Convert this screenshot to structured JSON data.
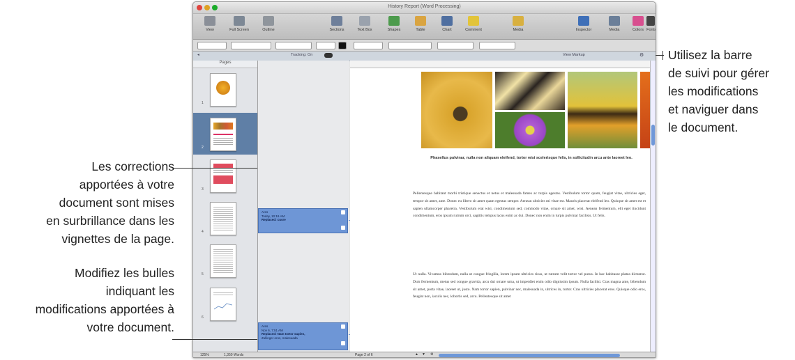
{
  "annotations": {
    "right": [
      "Utilisez la barre",
      "de suivi pour gérer",
      "les modifications",
      "et naviguer dans",
      "le document."
    ],
    "left_top": [
      "Les corrections",
      "apportées à votre",
      "document sont mises",
      "en surbrillance dans les",
      "vignettes de la page."
    ],
    "left_bottom": [
      "Modifiez les bulles",
      "indiquant les",
      "modifications apportées à",
      "votre document."
    ]
  },
  "window": {
    "title": "History Report (Word Processing)"
  },
  "toolbar": {
    "items": [
      {
        "label": "View",
        "icon": "view-icon"
      },
      {
        "label": "Full Screen",
        "icon": "full-screen-icon"
      },
      {
        "label": "Outline",
        "icon": "outline-icon"
      },
      {
        "label": "Sections",
        "icon": "sections-icon"
      },
      {
        "label": "Text Box",
        "icon": "text-box-icon"
      },
      {
        "label": "Shapes",
        "icon": "shapes-icon"
      },
      {
        "label": "Table",
        "icon": "table-icon"
      },
      {
        "label": "Chart",
        "icon": "chart-icon"
      },
      {
        "label": "Comment",
        "icon": "comment-icon"
      },
      {
        "label": "Media",
        "icon": "media-icon"
      },
      {
        "label": "Inspector",
        "icon": "inspector-icon"
      },
      {
        "label": "Media",
        "icon": "media-browser-icon"
      },
      {
        "label": "Colors",
        "icon": "colors-icon"
      },
      {
        "label": "Fonts",
        "icon": "fonts-icon"
      }
    ]
  },
  "trackbar": {
    "tracking_label": "Tracking: On",
    "view_label": "View Markup"
  },
  "sidebar": {
    "header": "Pages",
    "pages": [
      "1",
      "2",
      "3",
      "4",
      "5",
      "6"
    ]
  },
  "bubbles": [
    {
      "author": "Ares",
      "date": "Today, 10:19 AM",
      "change": "Replaced: cusre"
    },
    {
      "author": "Ares",
      "date": "Nov 6, 7:51 AM",
      "change": "Replaced: Nam tortor sapien,",
      "extra": "Zullinger eros, malesuada"
    }
  ],
  "document": {
    "caption": "Phasellus pulvinar, nulla non aliquam eleifend, tortor wisi scelerisque felis, in sollicitudin arcu ante laoreet leo.",
    "para1": "Pellentesque habitant morbi tristique senectus et netus et malesuada fames ac turpis egestas. Vestibulum tortor quam, feugiat vitae, ultricies eget, tempor sit amet, ante. Donec eu libero sit amet quam egestas semper. Aenean ultricies mi vitae est. Mauris placerat eleifend leo. Quisque sit amet est et sapien ullamcorper pharetra. Vestibulum erat wisi, condimentum sed, commodo vitae, ornare sit amet, wisi. Aenean fermentum, elit eget tincidunt condimentum, eros ipsum rutrum orci, sagittis tempus lacus enim ac dui. Donec non enim in turpis pulvinar facilisis. Ut felis.",
    "para2": "Ut nulla. Vivamus bibendum, nulla ut congue fringilla, lorem ipsum ultricies risus, ut rutrum velit tortor vel purus. In hac habitasse platea dictumst. Duis fermentum, metus sed congue gravida, arcu dui ornare urna, ut imperdiet enim odio dignissim ipsum. Nulla facilisi. Cras magna ante, bibendum sit amet, porta vitae, laoreet ut, justo. Nam tortor sapien, pulvinar nec, malesuada in, ultrices in, tortor. Cras ultricies placerat eros. Quisque odio eros, feugiat non, iaculis nec, lobortis sed, arcu. Pellentesque sit amet"
  },
  "status": {
    "zoom": "125%",
    "words": "1,350 Words",
    "page": "Page 2 of 6"
  }
}
